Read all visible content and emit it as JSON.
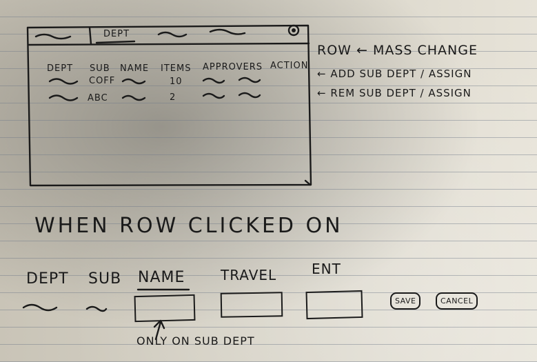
{
  "window": {
    "tab_label": "DEPT",
    "columns": [
      "DEPT",
      "SUB",
      "NAME",
      "ITEMS",
      "APPROVERS",
      "ACTION"
    ],
    "rows": [
      {
        "sub": "COFF",
        "items": "10"
      },
      {
        "sub": "ABC",
        "items": "2"
      }
    ]
  },
  "side_notes": {
    "row_mass": "ROW ← MASS CHANGE",
    "add": "← ADD SUB DEPT / ASSIGN",
    "rem": "← REM SUB DEPT / ASSIGN"
  },
  "heading": "WHEN ROW CLICKED ON",
  "edit_row": {
    "labels": [
      "DEPT",
      "SUB",
      "NAME",
      "TRAVEL",
      "ENT"
    ],
    "save_label": "SAVE",
    "cancel_label": "CANCEL",
    "note": "ONLY ON SUB DEPT"
  },
  "icons": {
    "close": "close-icon",
    "pointer": "arrow-up-icon"
  }
}
